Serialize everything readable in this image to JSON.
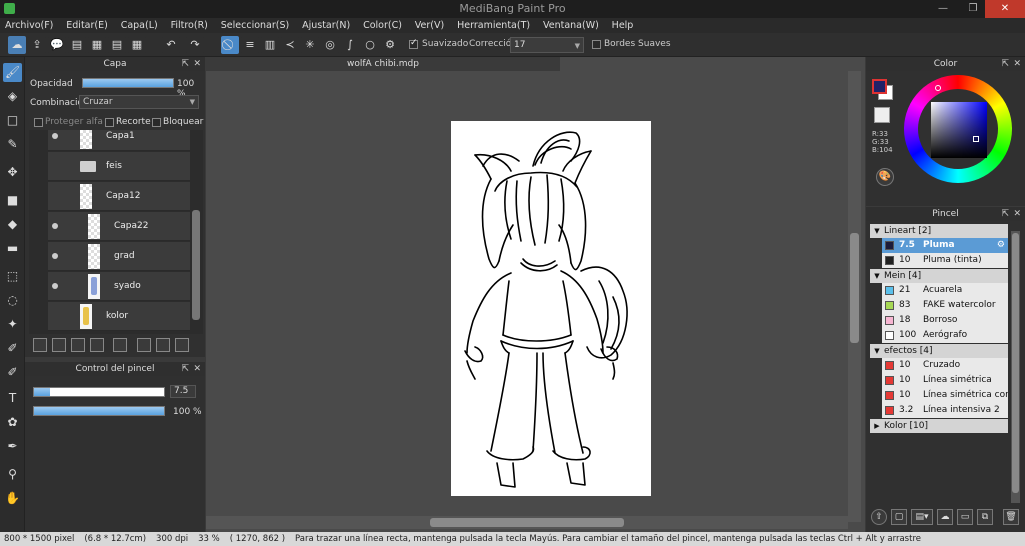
{
  "window": {
    "title": "MediBang Paint Pro",
    "minimize": "—",
    "maximize": "❐",
    "close": "✕"
  },
  "menu": [
    "Archivo(F)",
    "Editar(E)",
    "Capa(L)",
    "Filtro(R)",
    "Seleccionar(S)",
    "Ajustar(N)",
    "Color(C)",
    "Ver(V)",
    "Herramienta(T)",
    "Ventana(W)",
    "Help"
  ],
  "toolbar": {
    "suavizado_label": "Suavizado",
    "suavizado_checked": true,
    "correccion_label": "Corrección",
    "correccion_value": "17",
    "bordes_label": "Bordes Suaves",
    "bordes_checked": false
  },
  "layer_panel": {
    "title": "Capa",
    "opacity_label": "Opacidad",
    "opacity_value": "100 %",
    "opacity_fraction": 1.0,
    "blend_label": "Combinación",
    "blend_value": "Cruzar",
    "protect_alpha": "Proteger alfa",
    "clip": "Recorte",
    "lock": "Bloquear",
    "layers": [
      {
        "name": "Capa1",
        "visible": true,
        "indent": 0,
        "kind": "raster"
      },
      {
        "name": "feis",
        "visible": false,
        "indent": 0,
        "kind": "folder"
      },
      {
        "name": "Capa12",
        "visible": false,
        "indent": 0,
        "kind": "raster"
      },
      {
        "name": "Capa22",
        "visible": true,
        "indent": 1,
        "kind": "raster"
      },
      {
        "name": "grad",
        "visible": true,
        "indent": 1,
        "kind": "raster"
      },
      {
        "name": "syado",
        "visible": true,
        "indent": 1,
        "kind": "figure"
      },
      {
        "name": "kolor",
        "visible": false,
        "indent": 0,
        "kind": "figure"
      }
    ]
  },
  "brush_control": {
    "title": "Control del pincel",
    "size_value": "7.5",
    "size_fraction": 0.12,
    "opacity_value": "100 %",
    "opacity_fraction": 1.0
  },
  "document": {
    "tab": "wolfA chibi.mdp"
  },
  "color_panel": {
    "title": "Color",
    "foreground": "#212168",
    "background": "#ffffff",
    "r": "R:33",
    "g": "G:33",
    "b": "B:104"
  },
  "brush_panel": {
    "title": "Pincel",
    "groups": [
      {
        "name": "Lineart [2]",
        "expanded": true,
        "brushes": [
          {
            "size": "7.5",
            "name": "Pluma",
            "color": "#1c1c3a",
            "selected": true
          },
          {
            "size": "10",
            "name": "Pluma (tinta)",
            "color": "#222222",
            "selected": false
          }
        ]
      },
      {
        "name": "Mein [4]",
        "expanded": true,
        "brushes": [
          {
            "size": "21",
            "name": "Acuarela",
            "color": "#5bc0eb",
            "selected": false
          },
          {
            "size": "83",
            "name": "FAKE watercolor",
            "color": "#a6d854",
            "selected": false
          },
          {
            "size": "18",
            "name": "Borroso",
            "color": "#f7b6d2",
            "selected": false
          },
          {
            "size": "100",
            "name": "Aerógrafo",
            "color": "#ffffff",
            "selected": false
          }
        ]
      },
      {
        "name": "efectos [4]",
        "expanded": true,
        "brushes": [
          {
            "size": "10",
            "name": "Cruzado",
            "color": "#e53935",
            "selected": false
          },
          {
            "size": "10",
            "name": "Línea simétrica",
            "color": "#e53935",
            "selected": false
          },
          {
            "size": "10",
            "name": "Línea simétrica con c",
            "color": "#e53935",
            "selected": false
          },
          {
            "size": "3.2",
            "name": "Línea intensiva 2",
            "color": "#e53935",
            "selected": false
          }
        ]
      },
      {
        "name": "Kolor [10]",
        "expanded": false,
        "brushes": []
      }
    ]
  },
  "status": {
    "size": "800 * 1500 pixel",
    "cm": "(6.8 * 12.7cm)",
    "dpi": "300 dpi",
    "zoom": "33 %",
    "coords": "( 1270, 862 )",
    "hint": "Para trazar una línea recta, mantenga pulsada la tecla Mayús. Para cambiar el tamaño del pincel, mantenga pulsada las teclas Ctrl + Alt y arrastre"
  }
}
